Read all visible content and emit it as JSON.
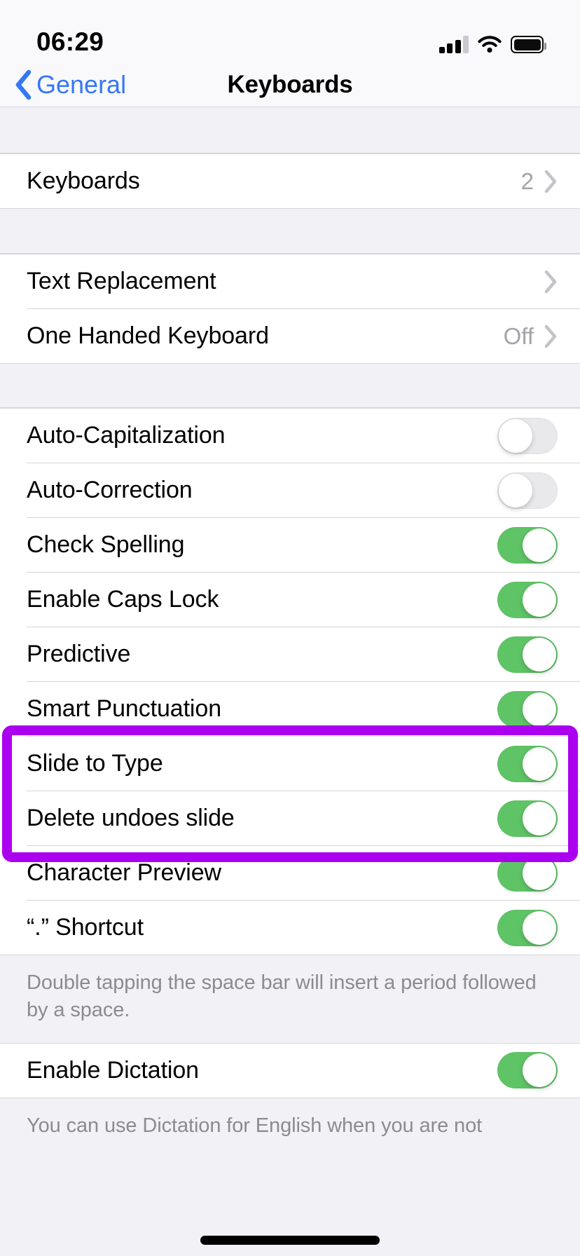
{
  "status_bar": {
    "time": "06:29",
    "cellular_icon": "signal-bars-icon",
    "cellular_bars_filled": 3,
    "cellular_bars_total": 4,
    "wifi_icon": "wifi-icon",
    "battery_icon": "battery-full-icon"
  },
  "nav": {
    "back_label": "General",
    "back_icon": "chevron-left-icon",
    "title": "Keyboards"
  },
  "colors": {
    "accent_blue": "#3478f6",
    "toggle_on_green": "#5fc466",
    "toggle_off_grey": "#e9e9eb",
    "highlight_purple": "#ab00ef",
    "group_background": "#ffffff",
    "page_background": "#f2f1f6",
    "secondary_text": "#8b8b90"
  },
  "sections": [
    {
      "id": "keyboards-section",
      "rows": [
        {
          "name": "keyboards",
          "label": "Keyboards",
          "value": "2",
          "accessory": "chevron-right-icon"
        }
      ]
    },
    {
      "id": "text-section",
      "rows": [
        {
          "name": "text-replacement",
          "label": "Text Replacement",
          "value": "",
          "accessory": "chevron-right-icon"
        },
        {
          "name": "one-handed-keyboard",
          "label": "One Handed Keyboard",
          "value": "Off",
          "accessory": "chevron-right-icon"
        }
      ]
    },
    {
      "id": "typing-options-section",
      "rows": [
        {
          "name": "auto-capitalization",
          "label": "Auto-Capitalization",
          "toggle": "off"
        },
        {
          "name": "auto-correction",
          "label": "Auto-Correction",
          "toggle": "off"
        },
        {
          "name": "check-spelling",
          "label": "Check Spelling",
          "toggle": "on"
        },
        {
          "name": "enable-caps-lock",
          "label": "Enable Caps Lock",
          "toggle": "on"
        },
        {
          "name": "predictive",
          "label": "Predictive",
          "toggle": "on"
        },
        {
          "name": "smart-punctuation",
          "label": "Smart Punctuation",
          "toggle": "on"
        },
        {
          "name": "slide-to-type",
          "label": "Slide to Type",
          "toggle": "on",
          "highlighted": true
        },
        {
          "name": "delete-undoes-slide",
          "label": "Delete undoes slide",
          "toggle": "on",
          "highlighted": true
        },
        {
          "name": "character-preview",
          "label": "Character Preview",
          "toggle": "on"
        },
        {
          "name": "period-shortcut",
          "label": "“.” Shortcut",
          "toggle": "on"
        }
      ],
      "footer": "Double tapping the space bar will insert a period followed by a space."
    },
    {
      "id": "dictation-section",
      "rows": [
        {
          "name": "enable-dictation",
          "label": "Enable Dictation",
          "toggle": "on"
        }
      ],
      "footer": "You can use Dictation for English when you are not"
    }
  ],
  "annotation": {
    "type": "highlight-box",
    "color": "#ab00ef",
    "targets": [
      "Slide to Type",
      "Delete undoes slide"
    ]
  },
  "home_indicator": {
    "name": "home-indicator"
  }
}
